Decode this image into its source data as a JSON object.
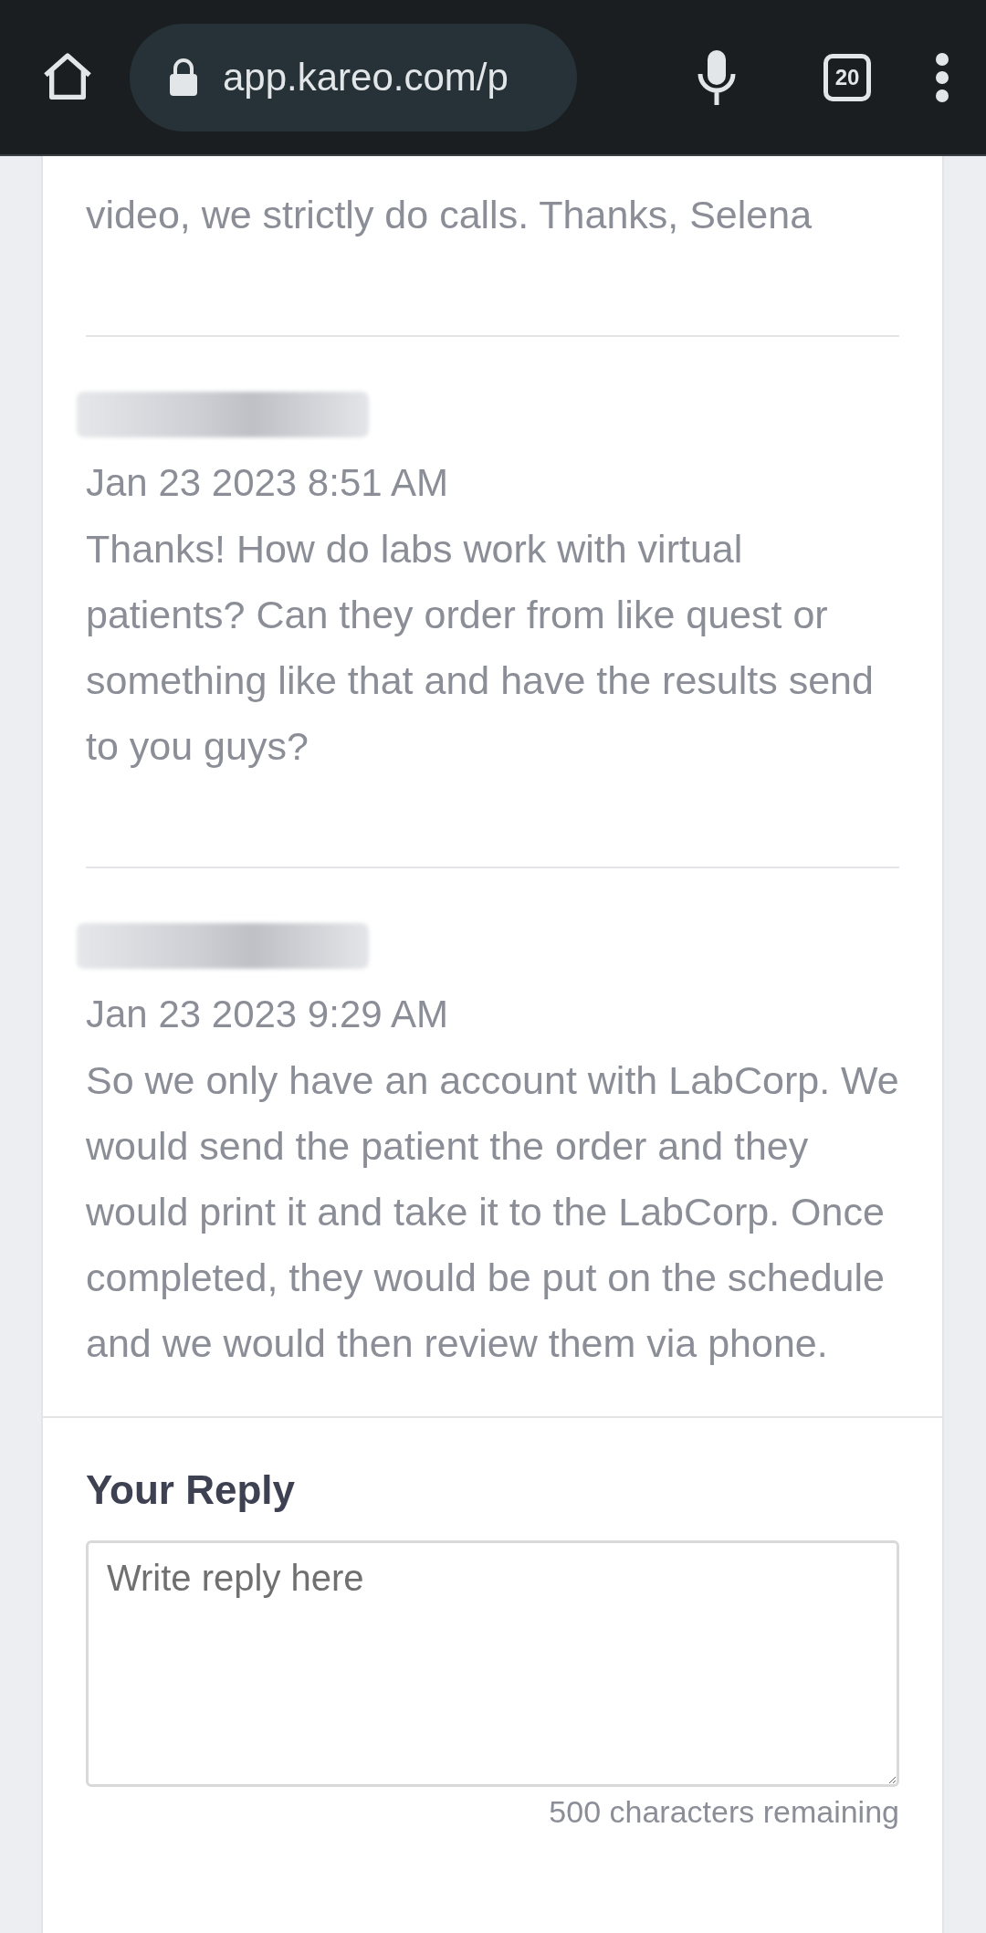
{
  "browser": {
    "url": "app.kareo.com/p",
    "tab_count": "20"
  },
  "messages": [
    {
      "kind": "tail",
      "text": "video, we strictly do calls. Thanks, Selena"
    },
    {
      "kind": "full",
      "sender_redacted": true,
      "date": "Jan 23 2023 8:51 AM",
      "text": "Thanks! How do labs work with virtual patients? Can they order from like quest or something like that and have the results send to you guys?"
    },
    {
      "kind": "full",
      "sender_redacted": true,
      "date": "Jan 23 2023 9:29 AM",
      "text": "So we only have an account with LabCorp. We would send the patient the order and they would print it and take it to the LabCorp. Once completed, they would be put on the schedule and we would then review them via phone."
    }
  ],
  "reply": {
    "heading": "Your Reply",
    "placeholder": "Write reply here",
    "counter": "500 characters remaining"
  }
}
